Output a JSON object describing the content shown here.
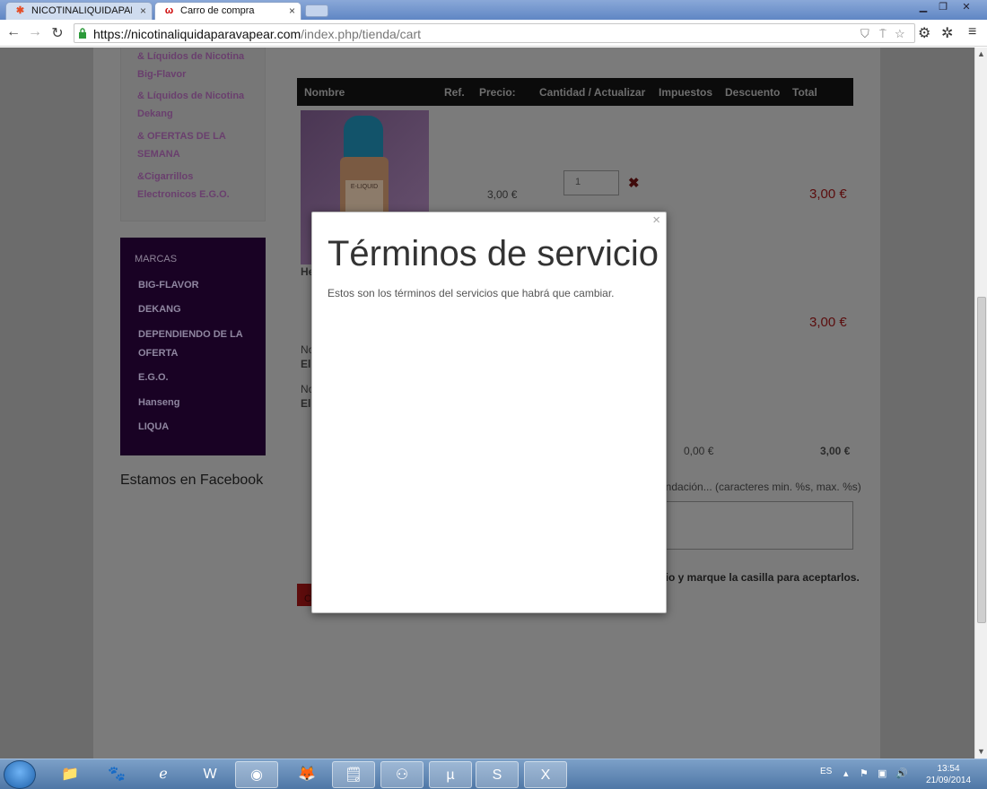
{
  "browser": {
    "tabs": [
      {
        "title": "NICOTINALIQUIDAPARAV",
        "favicon": "joomla-icon"
      },
      {
        "title": "Carro de compra",
        "favicon": "site-logo-icon"
      }
    ],
    "url_host": "https://nicotinaliquidaparavapear.com",
    "url_path": "/index.php/tienda/cart"
  },
  "sidebar": {
    "categories": [
      "& Líquidos de Nicotina Big-Flavor",
      "& Líquidos de Nicotina Dekang",
      "& OFERTAS DE LA SEMANA",
      "&Cigarrillos Electronicos E.G.O."
    ],
    "brands_heading": "MARCAS",
    "brands": [
      "BIG-FLAVOR",
      "DEKANG",
      "DEPENDIENDO DE LA OFERTA",
      "E.G.O.",
      "Hanseng",
      "LIQUA"
    ],
    "facebook_heading": "Estamos en Facebook"
  },
  "cart": {
    "headers": [
      "Nombre",
      "Ref.",
      "Precio:",
      "Cantidad / Actualizar",
      "Impuestos",
      "Descuento",
      "Total"
    ],
    "item_price": "3,00 €",
    "quantity": "1",
    "item_total": "3,00 €",
    "subtotal": "3,00 €",
    "tax": "0,00 €",
    "total": "3,00 €",
    "bottle_label": "E-LIQUID",
    "partial_he": "He",
    "partial_no": "No",
    "partial_el": "El",
    "comment_hint": "endación... (caracteres min. %s, max. %s)",
    "terms_hint": "cio y marque la casilla para aceptarlos.",
    "button_partial": "C"
  },
  "modal": {
    "title": "Términos de servicio",
    "body": "Estos son los términos del servicios que habrá que cambiar.",
    "close": "×"
  },
  "taskbar": {
    "language": "ES",
    "time": "13:54",
    "date": "21/09/2014"
  }
}
